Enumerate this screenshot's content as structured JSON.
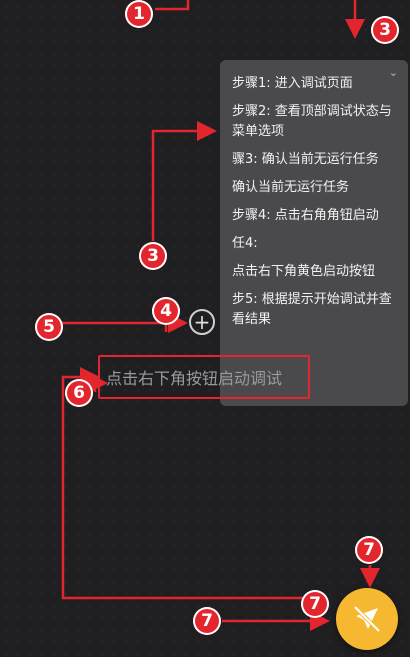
{
  "panel": {
    "steps": [
      "步骤1: 进入调试页面",
      "步骤2: 查看顶部调试状态与菜单选项",
      "骤3: 确认当前无运行任务",
      "确认当前无运行任务",
      "步骤4: 点击右角角钮启动",
      "任4:",
      "点击右下角黄色启动按钮",
      "步5: 根据提示开始调试并查看结果"
    ]
  },
  "hint": {
    "text": "点击右下角按钮启动调试"
  },
  "badges": [
    "1",
    "3",
    "3",
    "4",
    "5",
    "6",
    "7",
    "7",
    "7"
  ],
  "colors": {
    "accent": "#e3262e",
    "fab": "#f6b830",
    "panel": "#4a4a4d",
    "background": "#1f1f21"
  },
  "icons": {
    "add": "plus-circle-icon",
    "launch": "rocket-off-icon",
    "collapse": "chevron-down-icon"
  }
}
